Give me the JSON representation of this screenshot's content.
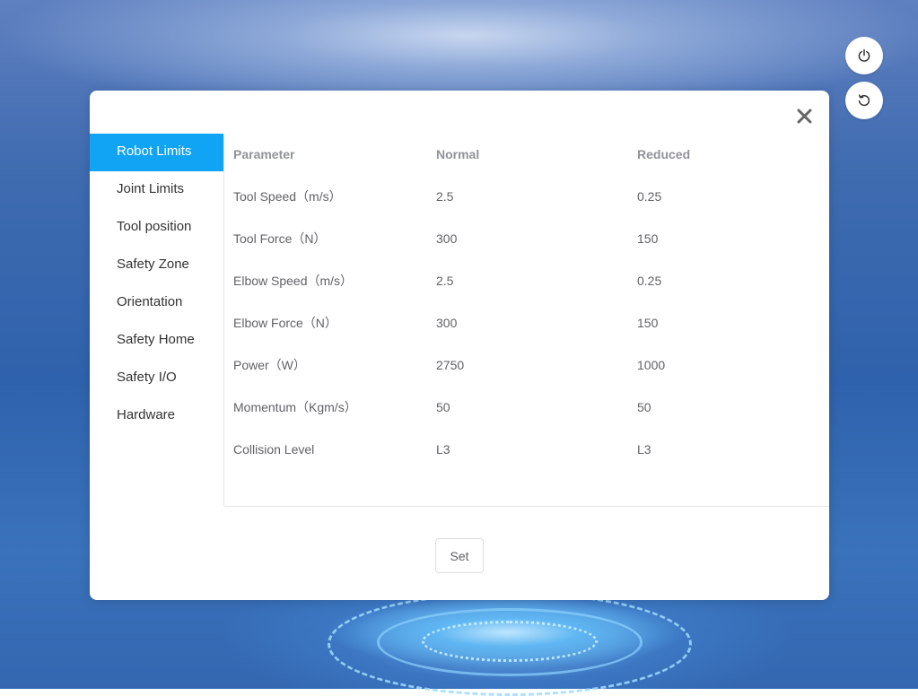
{
  "side_buttons": {
    "power_icon": "power-icon",
    "reset_icon": "reset-icon"
  },
  "dialog": {
    "close_icon": "close-icon",
    "menu": [
      {
        "label": "Robot Limits",
        "active": true
      },
      {
        "label": "Joint Limits",
        "active": false
      },
      {
        "label": "Tool position",
        "active": false
      },
      {
        "label": "Safety Zone",
        "active": false
      },
      {
        "label": "Orientation",
        "active": false
      },
      {
        "label": "Safety Home",
        "active": false
      },
      {
        "label": "Safety I/O",
        "active": false
      },
      {
        "label": "Hardware",
        "active": false
      }
    ],
    "table": {
      "headers": [
        "Parameter",
        "Normal",
        "Reduced"
      ],
      "rows": [
        [
          "Tool Speed（m/s）",
          "2.5",
          "0.25"
        ],
        [
          "Tool Force（N）",
          "300",
          "150"
        ],
        [
          "Elbow Speed（m/s）",
          "2.5",
          "0.25"
        ],
        [
          "Elbow Force（N）",
          "300",
          "150"
        ],
        [
          "Power（W）",
          "2750",
          "1000"
        ],
        [
          "Momentum（Kgm/s）",
          "50",
          "50"
        ],
        [
          "Collision Level",
          "L3",
          "L3"
        ]
      ]
    },
    "set_label": "Set"
  },
  "colors": {
    "accent": "#11a4f5",
    "header_text": "#909399",
    "cell_text": "#606266"
  }
}
